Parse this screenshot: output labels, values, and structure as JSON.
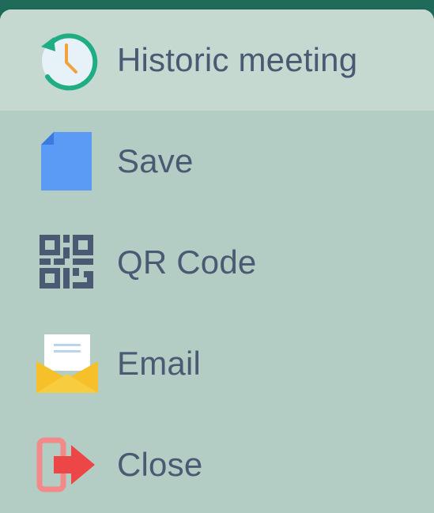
{
  "menu": {
    "items": [
      {
        "label": "Historic meeting",
        "icon": "history-clock-icon",
        "highlighted": true
      },
      {
        "label": "Save",
        "icon": "document-icon",
        "highlighted": false
      },
      {
        "label": "QR Code",
        "icon": "qr-code-icon",
        "highlighted": false
      },
      {
        "label": "Email",
        "icon": "email-icon",
        "highlighted": false
      },
      {
        "label": "Close",
        "icon": "exit-icon",
        "highlighted": false
      }
    ]
  },
  "colors": {
    "background": "#1f6a58",
    "menu_background": "#b4cdc4",
    "highlight": "#c5d9d1",
    "label_text": "#4a5a73"
  }
}
